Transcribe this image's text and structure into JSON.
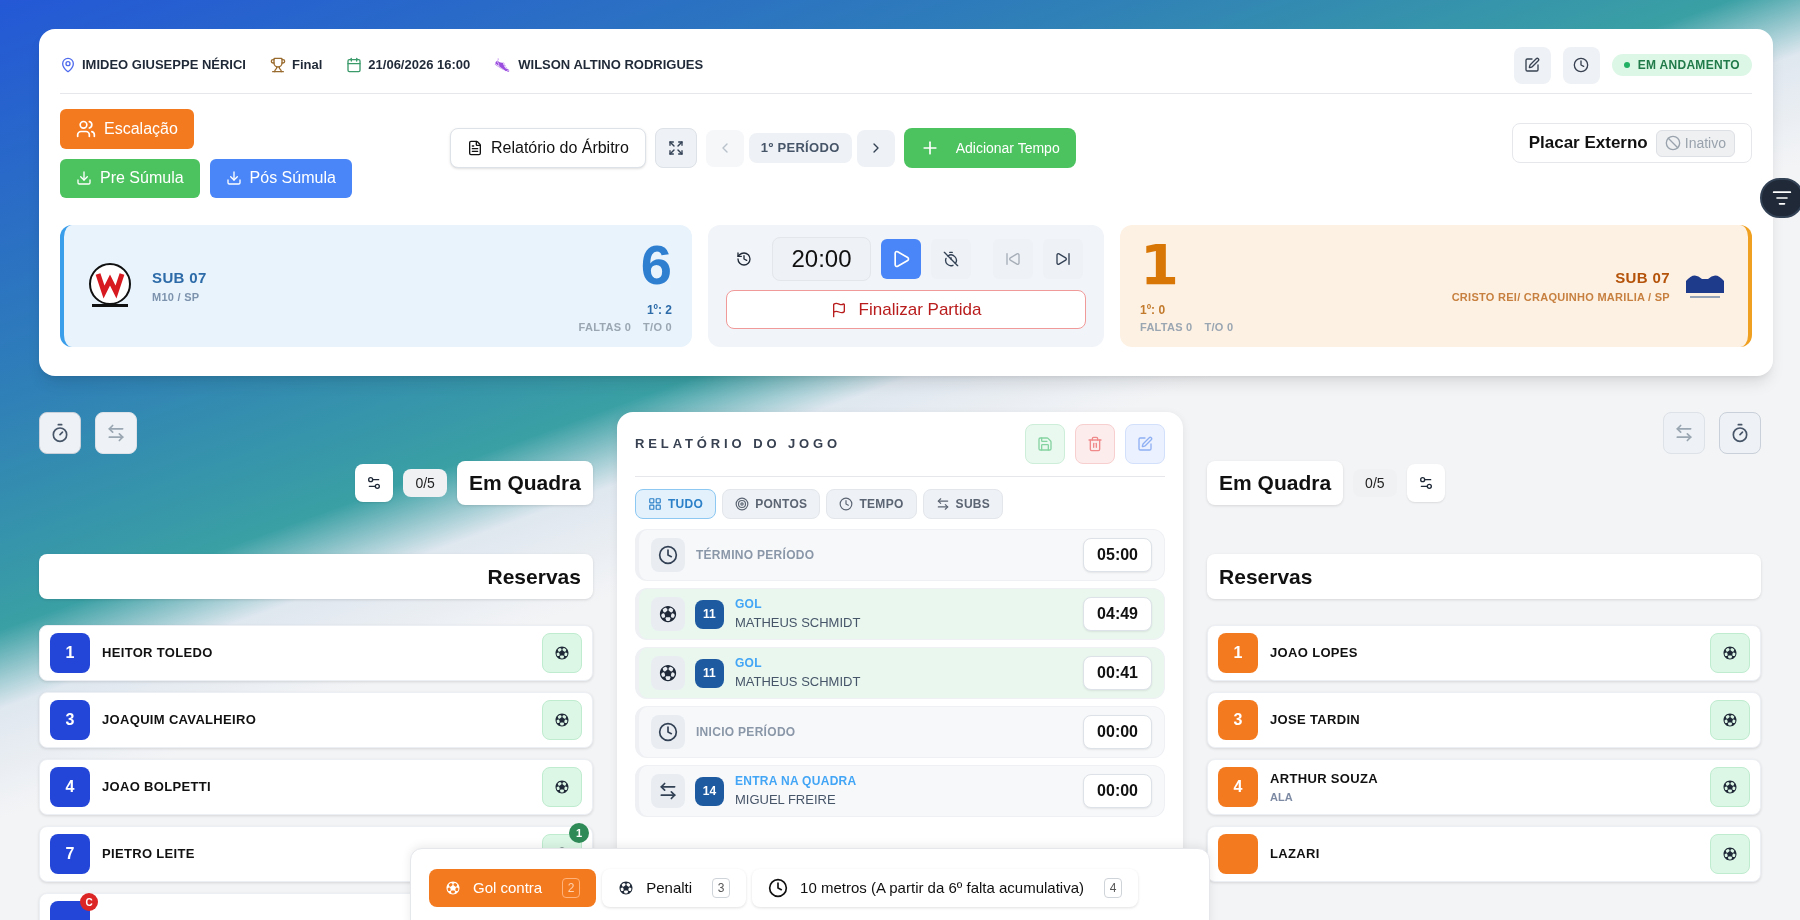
{
  "match_info": {
    "venue": "IMIDEO GIUSEPPE NÉRICI",
    "stage": "Final",
    "datetime": "21/06/2026 16:00",
    "referee": "WILSON ALTINO RODRIGUES"
  },
  "status": {
    "label": "EM ANDAMENTO"
  },
  "actions": {
    "lineup": "Escalação",
    "pre": "Pre Súmula",
    "post": "Pós Súmula",
    "report": "Relatório do Árbitro",
    "period": "1º PERÍODO",
    "add_time": "Adicionar Tempo"
  },
  "external_scoreboard": {
    "label": "Placar Externo",
    "state": "Inativo",
    "on": false
  },
  "home": {
    "category": "SUB 07",
    "team": "M10 / SP",
    "score": "6",
    "period_score": "1º: 2",
    "fouls": "FALTAS 0",
    "timeouts": "T/O 0"
  },
  "clock": {
    "time": "20:00",
    "finish": "Finalizar Partida"
  },
  "away": {
    "category": "SUB 07",
    "team": "CRISTO REI/ CRAQUINHO MARILIA / SP",
    "score": "1",
    "period_score": "1º: 0",
    "fouls": "FALTAS 0",
    "timeouts": "T/O 0"
  },
  "home_panel": {
    "on_court": "Em Quadra",
    "count": "0/5",
    "reserves": "Reservas",
    "players": [
      {
        "number": "1",
        "name": "HEITOR TOLEDO"
      },
      {
        "number": "3",
        "name": "JOAQUIM CAVALHEIRO"
      },
      {
        "number": "4",
        "name": "JOAO BOLPETTI"
      },
      {
        "number": "7",
        "name": "PIETRO LEITE",
        "goals": "1"
      },
      {
        "captain": "C"
      }
    ]
  },
  "away_panel": {
    "on_court": "Em Quadra",
    "count": "0/5",
    "reserves": "Reservas",
    "players": [
      {
        "number": "1",
        "name": "JOAO LOPES"
      },
      {
        "number": "3",
        "name": "JOSE TARDIN"
      },
      {
        "number": "4",
        "name": "ARTHUR SOUZA",
        "position": "ALA"
      },
      {
        "name": "LAZARI"
      }
    ]
  },
  "report": {
    "title": "RELATÓRIO DO JOGO",
    "filters": [
      {
        "label": "TUDO",
        "selected": true
      },
      {
        "label": "PONTOS",
        "selected": false
      },
      {
        "label": "TEMPO",
        "selected": false
      },
      {
        "label": "SUBS",
        "selected": false
      }
    ],
    "events": [
      {
        "kind": "period",
        "title": "TÉRMINO PERÍODO",
        "time": "05:00"
      },
      {
        "kind": "goal",
        "number": "11",
        "title": "GOL",
        "player": "MATHEUS SCHMIDT",
        "time": "04:49"
      },
      {
        "kind": "goal",
        "number": "11",
        "title": "GOL",
        "player": "MATHEUS SCHMIDT",
        "time": "00:41"
      },
      {
        "kind": "period",
        "title": "INICIO PERÍODO",
        "time": "00:00"
      },
      {
        "kind": "sub",
        "number": "14",
        "title": "ENTRA NA QUADRA",
        "player": "MIGUEL FREIRE",
        "time": "00:00"
      }
    ]
  },
  "penalty_bar": {
    "options": [
      {
        "kind": "ball",
        "label": "Gol contra",
        "count": "2",
        "selected": true
      },
      {
        "kind": "ball",
        "label": "Penalti",
        "count": "3",
        "selected": false
      },
      {
        "kind": "clock",
        "label": "10 metros (A partir da 6º falta acumulativa)",
        "count": "4",
        "selected": false
      }
    ]
  }
}
